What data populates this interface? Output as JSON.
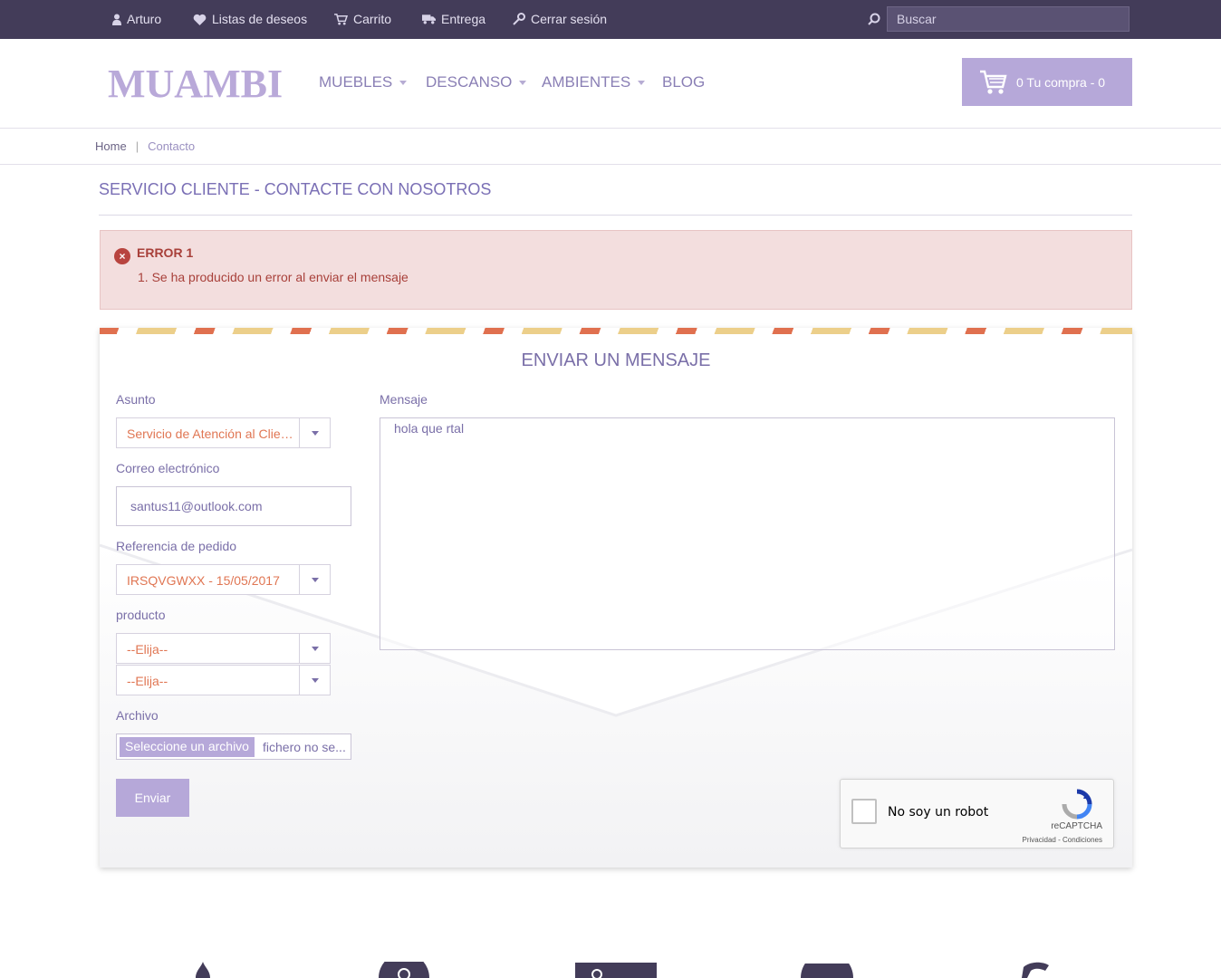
{
  "topbar": {
    "user": "Arturo",
    "wishlist": "Listas de deseos",
    "cart": "Carrito",
    "delivery": "Entrega",
    "logout": "Cerrar sesión",
    "search_placeholder": "Buscar"
  },
  "header": {
    "logo": "MUAMBI",
    "nav": [
      "MUEBLES",
      "DESCANSO",
      "AMBIENTES",
      "BLOG"
    ],
    "cart_label": "0 Tu compra - 0"
  },
  "breadcrumb": {
    "home": "Home",
    "separator": "|",
    "current": "Contacto"
  },
  "page_title": "SERVICIO CLIENTE - CONTACTE CON NOSOTROS",
  "error": {
    "title": "ERROR 1",
    "message": "1. Se ha producido un error al enviar el mensaje"
  },
  "form": {
    "title": "ENVIAR UN MENSAJE",
    "subject_label": "Asunto",
    "subject_value": "Servicio de Atención al Cliente",
    "email_label": "Correo electrónico",
    "email_value": "santus11@outlook.com",
    "order_label": "Referencia de pedido",
    "order_value": "IRSQVGWXX - 15/05/2017",
    "product_label": "producto",
    "product_value_1": "--Elija--",
    "product_value_2": "--Elija--",
    "file_label": "Archivo",
    "file_button": "Seleccione un archivo",
    "file_name": "fichero no se...",
    "message_label": "Mensaje",
    "message_value": "hola que rtal",
    "send_button": "Enviar"
  },
  "captcha": {
    "label": "No soy un robot",
    "brand": "reCAPTCHA",
    "terms": "Privacidad - Condiciones"
  },
  "colors": {
    "topbar": "#433c59",
    "accent": "#b6a8d9",
    "error_bg": "#f3dede",
    "error_text": "#a8403a",
    "select_text": "#e07653"
  }
}
